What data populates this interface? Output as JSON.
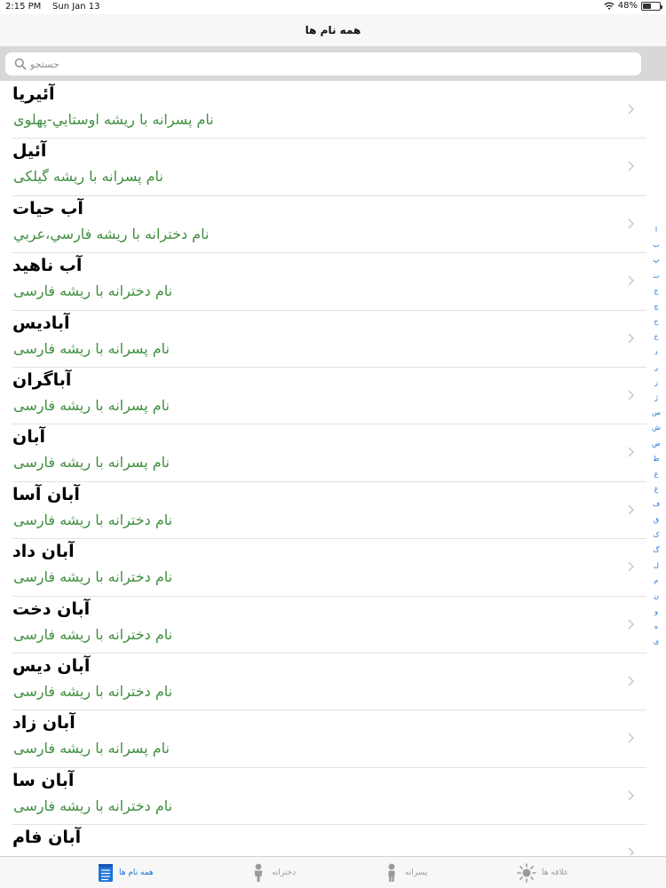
{
  "status_bar": {
    "time": "2:15 PM",
    "date": "Sun Jan 13",
    "battery": "48%",
    "battery_level": 0.48
  },
  "nav": {
    "title": "همه نام ها"
  },
  "search": {
    "placeholder": "جستجو",
    "value": ""
  },
  "names": [
    {
      "name": "آئيريا",
      "desc": "نام پسرانه با ريشه اوستايي-پهلوی"
    },
    {
      "name": "آئيل",
      "desc": "نام پسرانه با ريشه گیلکی"
    },
    {
      "name": "آب حيات",
      "desc": "نام دخترانه با ريشه فارسي،عربي"
    },
    {
      "name": "آب ناهيد",
      "desc": "نام دخترانه با ريشه فارسی"
    },
    {
      "name": "آباديس",
      "desc": "نام پسرانه با ريشه فارسی"
    },
    {
      "name": "آباگران",
      "desc": "نام پسرانه با ريشه فارسی"
    },
    {
      "name": "آبان",
      "desc": "نام پسرانه با ريشه فارسی"
    },
    {
      "name": "آبان آسا",
      "desc": "نام دخترانه با ريشه فارسی"
    },
    {
      "name": "آبان داد",
      "desc": "نام دخترانه با ريشه فارسی"
    },
    {
      "name": "آبان دخت",
      "desc": "نام دخترانه با ريشه فارسی"
    },
    {
      "name": "آبان ديس",
      "desc": "نام دخترانه با ريشه فارسی"
    },
    {
      "name": "آبان زاد",
      "desc": "نام پسرانه با ريشه فارسی"
    },
    {
      "name": "آبان سا",
      "desc": "نام دخترانه با ريشه فارسی"
    },
    {
      "name": "آبان فام",
      "desc": ""
    }
  ],
  "index_letters": [
    "ا",
    "ب",
    "پ",
    "ت",
    "ج",
    "چ",
    "ح",
    "خ",
    "د",
    "ر",
    "ز",
    "ژ",
    "س",
    "ش",
    "ص",
    "ط",
    "ع",
    "غ",
    "ف",
    "ق",
    "ک",
    "گ",
    "ل",
    "م",
    "ن",
    "و",
    "ه",
    "ی"
  ],
  "tabs": [
    {
      "label": "همه نام ها",
      "icon": "list-icon",
      "active": true
    },
    {
      "label": "دخترانه",
      "icon": "girl-icon",
      "active": false
    },
    {
      "label": "پسرانه",
      "icon": "boy-icon",
      "active": false
    },
    {
      "label": "علاقه ها",
      "icon": "sun-icon",
      "active": false
    }
  ],
  "colors": {
    "accent": "#1e74d8",
    "desc_green": "#3f8f3f",
    "chevron": "#c7c7cc"
  }
}
